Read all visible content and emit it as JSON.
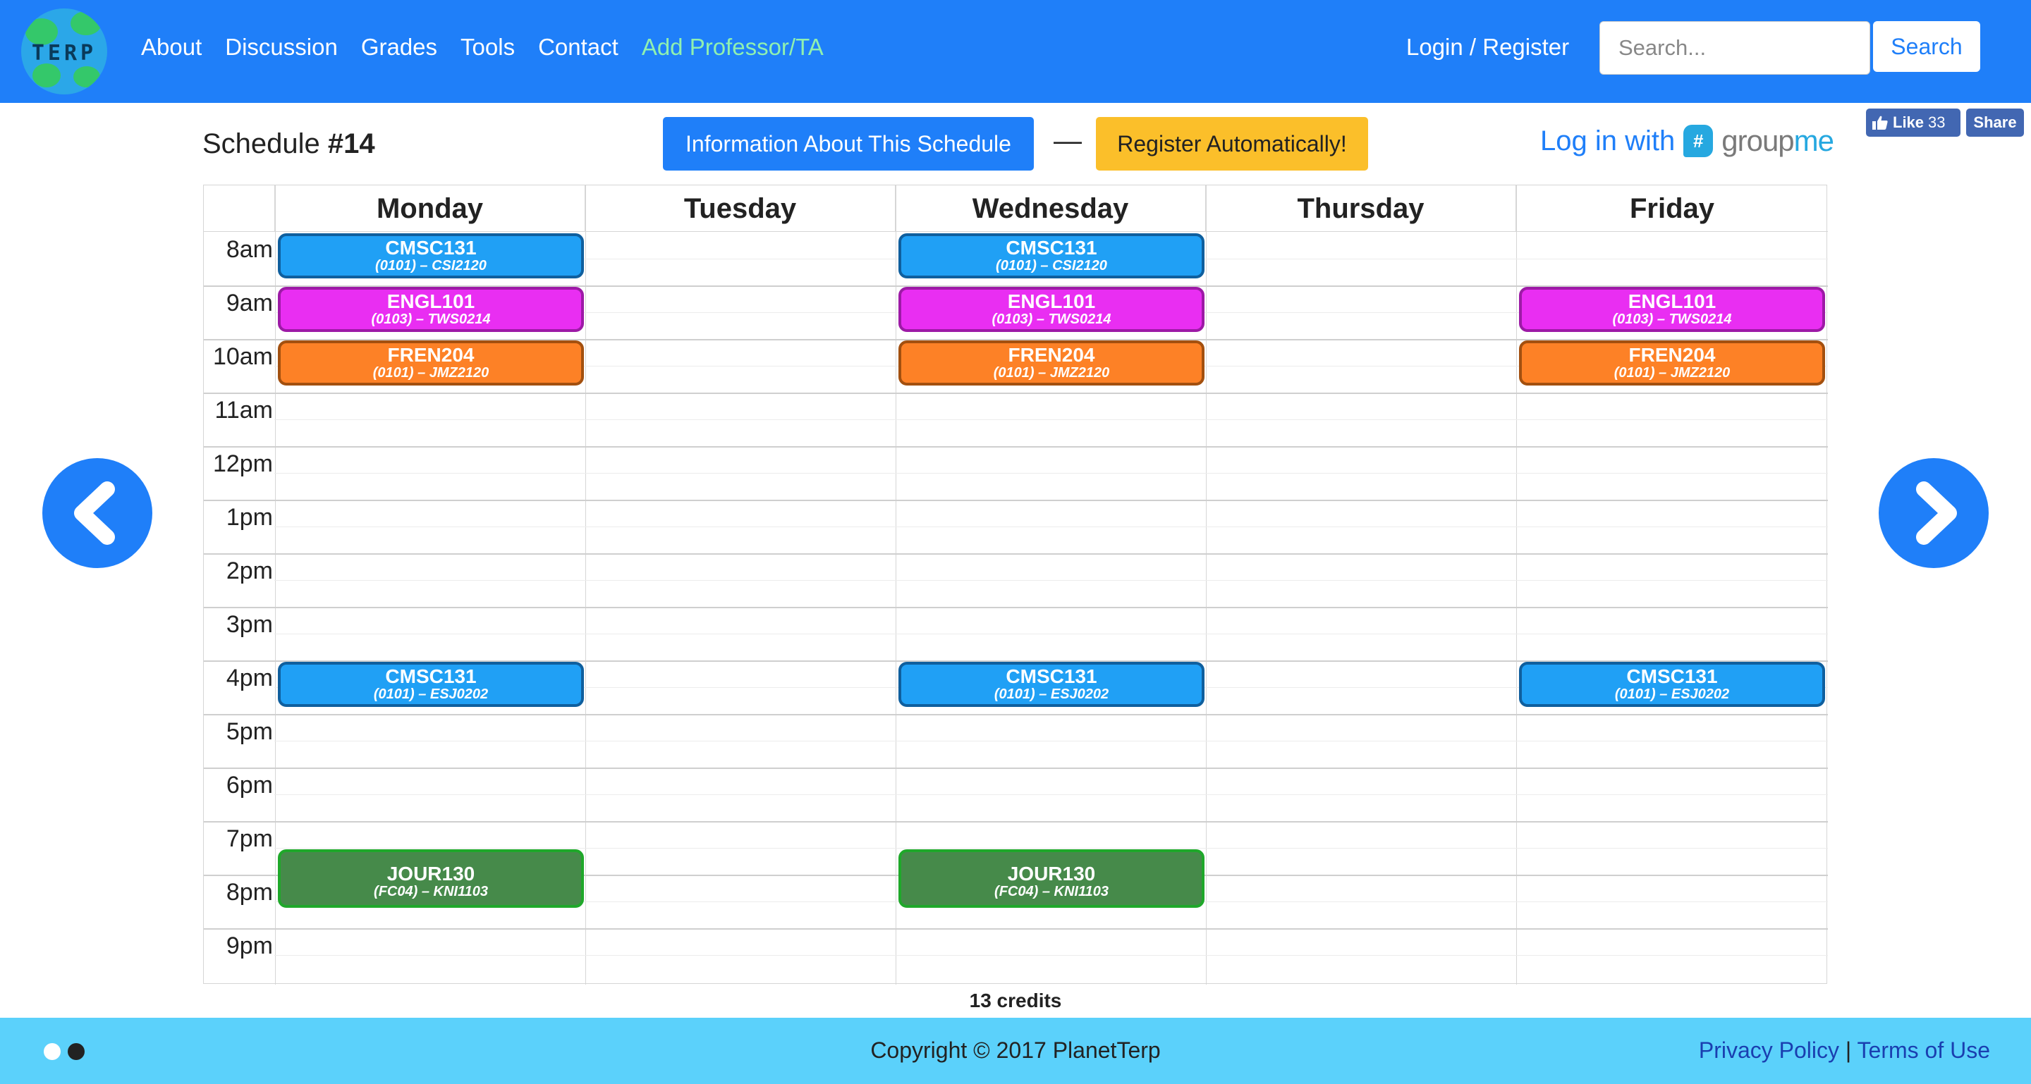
{
  "navbar": {
    "logo_text": "TERP",
    "links": [
      "About",
      "Discussion",
      "Grades",
      "Tools",
      "Contact"
    ],
    "add_professor": "Add Professor/TA",
    "login": "Login / Register",
    "search_placeholder": "Search...",
    "search_button": "Search",
    "color": "#1f7ff9"
  },
  "social": {
    "like_label": "Like",
    "like_count": "33",
    "share_label": "Share"
  },
  "header": {
    "title_prefix": "Schedule ",
    "title_number": "#14",
    "info_button": "Information About This Schedule",
    "dash": "—",
    "register_button": "Register Automatically!",
    "groupme_prefix": "Log in with",
    "groupme_badge": "#",
    "groupme_brand_a": "group",
    "groupme_brand_b": "me"
  },
  "calendar": {
    "days": [
      "Monday",
      "Tuesday",
      "Wednesday",
      "Thursday",
      "Friday"
    ],
    "hours": [
      "8am",
      "9am",
      "10am",
      "11am",
      "12pm",
      "1pm",
      "2pm",
      "3pm",
      "4pm",
      "5pm",
      "6pm",
      "7pm",
      "8pm",
      "9pm"
    ],
    "events": [
      {
        "code": "CMSC131",
        "detail": "(0101) – CSI2120",
        "day": 0,
        "start": 8,
        "end": 9,
        "color": "cmsc"
      },
      {
        "code": "CMSC131",
        "detail": "(0101) – CSI2120",
        "day": 2,
        "start": 8,
        "end": 9,
        "color": "cmsc"
      },
      {
        "code": "ENGL101",
        "detail": "(0103) – TWS0214",
        "day": 0,
        "start": 9,
        "end": 10,
        "color": "engl"
      },
      {
        "code": "ENGL101",
        "detail": "(0103) – TWS0214",
        "day": 2,
        "start": 9,
        "end": 10,
        "color": "engl"
      },
      {
        "code": "ENGL101",
        "detail": "(0103) – TWS0214",
        "day": 4,
        "start": 9,
        "end": 10,
        "color": "engl"
      },
      {
        "code": "FREN204",
        "detail": "(0101) – JMZ2120",
        "day": 0,
        "start": 10,
        "end": 11,
        "color": "fren"
      },
      {
        "code": "FREN204",
        "detail": "(0101) – JMZ2120",
        "day": 2,
        "start": 10,
        "end": 11,
        "color": "fren"
      },
      {
        "code": "FREN204",
        "detail": "(0101) – JMZ2120",
        "day": 4,
        "start": 10,
        "end": 11,
        "color": "fren"
      },
      {
        "code": "CMSC131",
        "detail": "(0101) – ESJ0202",
        "day": 0,
        "start": 16,
        "end": 17,
        "color": "cmsc"
      },
      {
        "code": "CMSC131",
        "detail": "(0101) – ESJ0202",
        "day": 2,
        "start": 16,
        "end": 17,
        "color": "cmsc"
      },
      {
        "code": "CMSC131",
        "detail": "(0101) – ESJ0202",
        "day": 4,
        "start": 16,
        "end": 17,
        "color": "cmsc"
      },
      {
        "code": "JOUR130",
        "detail": "(FC04) – KNI1103",
        "day": 0,
        "start": 19.5,
        "end": 20.75,
        "color": "jour"
      },
      {
        "code": "JOUR130",
        "detail": "(FC04) – KNI1103",
        "day": 2,
        "start": 19.5,
        "end": 20.75,
        "color": "jour"
      }
    ],
    "colors": {
      "cmsc": {
        "bg": "#20a0f5",
        "border": "#0f5f9e"
      },
      "engl": {
        "bg": "#e92ef2",
        "border": "#9d1aa6"
      },
      "fren": {
        "bg": "#fd8126",
        "border": "#a3500f"
      },
      "jour": {
        "bg": "#468a4a",
        "border": "#1fa82a"
      }
    }
  },
  "credits": "13 credits",
  "footer": {
    "copyright": "Copyright © 2017 PlanetTerp",
    "privacy": "Privacy Policy",
    "separator": " | ",
    "terms": "Terms of Use",
    "color": "#5bd1fb"
  }
}
